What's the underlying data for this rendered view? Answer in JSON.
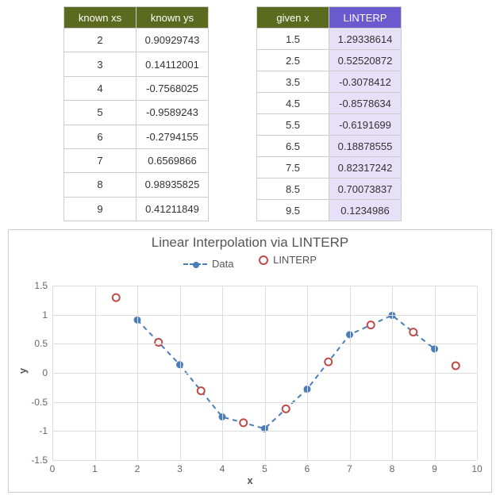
{
  "tables": {
    "known": {
      "headers": [
        "known xs",
        "known ys"
      ],
      "rows": [
        [
          2,
          "0.90929743"
        ],
        [
          3,
          "0.14112001"
        ],
        [
          4,
          "-0.7568025"
        ],
        [
          5,
          "-0.9589243"
        ],
        [
          6,
          "-0.2794155"
        ],
        [
          7,
          "0.6569866"
        ],
        [
          8,
          "0.98935825"
        ],
        [
          9,
          "0.41211849"
        ]
      ]
    },
    "given": {
      "headers": [
        "given x",
        "LINTERP"
      ],
      "rows": [
        [
          "1.5",
          "1.29338614"
        ],
        [
          "2.5",
          "0.52520872"
        ],
        [
          "3.5",
          "-0.3078412"
        ],
        [
          "4.5",
          "-0.8578634"
        ],
        [
          "5.5",
          "-0.6191699"
        ],
        [
          "6.5",
          "0.18878555"
        ],
        [
          "7.5",
          "0.82317242"
        ],
        [
          "8.5",
          "0.70073837"
        ],
        [
          "9.5",
          "0.1234986"
        ]
      ]
    }
  },
  "chart_data": {
    "type": "scatter",
    "title": "Linear Interpolation via LINTERP",
    "xlabel": "x",
    "ylabel": "y",
    "xlim": [
      0,
      10
    ],
    "ylim": [
      -1.5,
      1.5
    ],
    "xticks": [
      0,
      1,
      2,
      3,
      4,
      5,
      6,
      7,
      8,
      9,
      10
    ],
    "yticks": [
      -1.5,
      -1,
      -0.5,
      0,
      0.5,
      1,
      1.5
    ],
    "series": [
      {
        "name": "Data",
        "style": "dashed-line-with-filled-markers",
        "color": "#4a7ebb",
        "x": [
          2,
          3,
          4,
          5,
          6,
          7,
          8,
          9
        ],
        "y": [
          0.90929743,
          0.14112001,
          -0.7568025,
          -0.9589243,
          -0.2794155,
          0.6569866,
          0.98935825,
          0.41211849
        ]
      },
      {
        "name": "LINTERP",
        "style": "open-circle-markers",
        "color": "#be4b48",
        "x": [
          1.5,
          2.5,
          3.5,
          4.5,
          5.5,
          6.5,
          7.5,
          8.5,
          9.5
        ],
        "y": [
          1.29338614,
          0.52520872,
          -0.3078412,
          -0.8578634,
          -0.6191699,
          0.18878555,
          0.82317242,
          0.70073837,
          0.1234986
        ]
      }
    ]
  },
  "legend": {
    "data": "Data",
    "linterp": "LINTERP"
  }
}
